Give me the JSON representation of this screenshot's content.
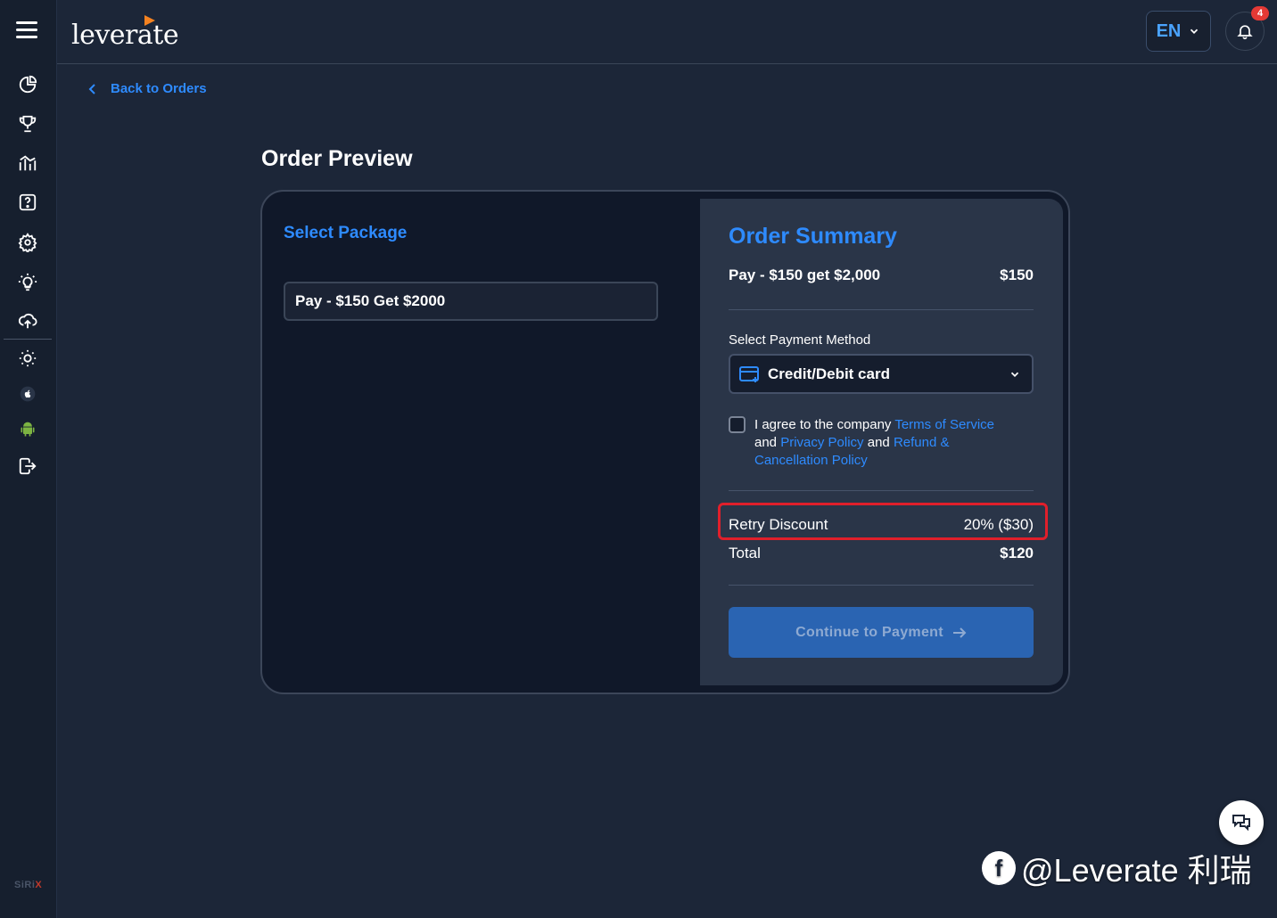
{
  "brand": {
    "logo_text": "leverate",
    "watermark": "@Leverate 利瑞",
    "platform_mark_a": "SiRi",
    "platform_mark_b": "X"
  },
  "header": {
    "language": "EN",
    "notification_count": "4"
  },
  "nav": {
    "back_label": "Back to Orders"
  },
  "page": {
    "title": "Order Preview"
  },
  "package": {
    "section_title": "Select Package",
    "selected": "Pay - $150 Get $2000"
  },
  "summary": {
    "title": "Order Summary",
    "item_label": "Pay - $150 get $2,000",
    "item_price": "$150",
    "payment_method_label": "Select Payment Method",
    "payment_method_value": "Credit/Debit card",
    "agree_prefix": "I agree to the company ",
    "terms_link": "Terms of Service",
    "agree_and1": " and ",
    "privacy_link": "Privacy Policy",
    "agree_and2": " and ",
    "refund_link": "Refund & Cancellation Policy",
    "discount_label": "Retry Discount",
    "discount_value": "20% ($30)",
    "total_label": "Total",
    "total_value": "$120",
    "continue_label": "Continue to Payment"
  },
  "colors": {
    "accent": "#2e8bff",
    "highlight": "#e01f2b",
    "badge": "#e53935",
    "android": "#7cb342"
  }
}
